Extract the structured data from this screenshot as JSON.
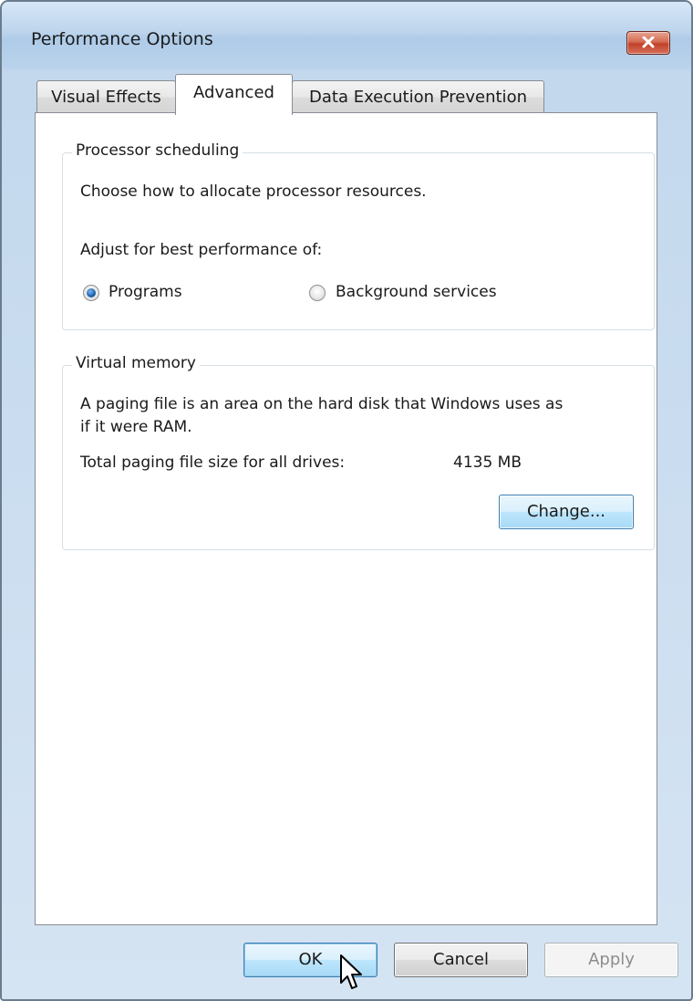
{
  "window": {
    "title": "Performance Options"
  },
  "tabs": [
    {
      "label": "Visual Effects",
      "selected": false
    },
    {
      "label": "Advanced",
      "selected": true
    },
    {
      "label": "Data Execution Prevention",
      "selected": false
    }
  ],
  "processor_scheduling": {
    "group_label": "Processor scheduling",
    "description": "Choose how to allocate processor resources.",
    "adjust_label": "Adjust for best performance of:",
    "options": [
      {
        "label": "Programs",
        "checked": true
      },
      {
        "label": "Background services",
        "checked": false
      }
    ]
  },
  "virtual_memory": {
    "group_label": "Virtual memory",
    "description_line1": "A paging file is an area on the hard disk that Windows uses as",
    "description_line2": "if it were RAM.",
    "total_label": "Total paging file size for all drives:",
    "total_value": "4135 MB",
    "change_button": "Change..."
  },
  "footer": {
    "ok_label": "OK",
    "cancel_label": "Cancel",
    "apply_label": "Apply",
    "apply_enabled": false
  },
  "icons": {
    "close": "close-icon",
    "cursor": "mouse-pointer-icon"
  },
  "colors": {
    "accent_border": "#3c7fb1",
    "close_button": "#c1412a",
    "radio_selected": "#1b5fa8"
  }
}
